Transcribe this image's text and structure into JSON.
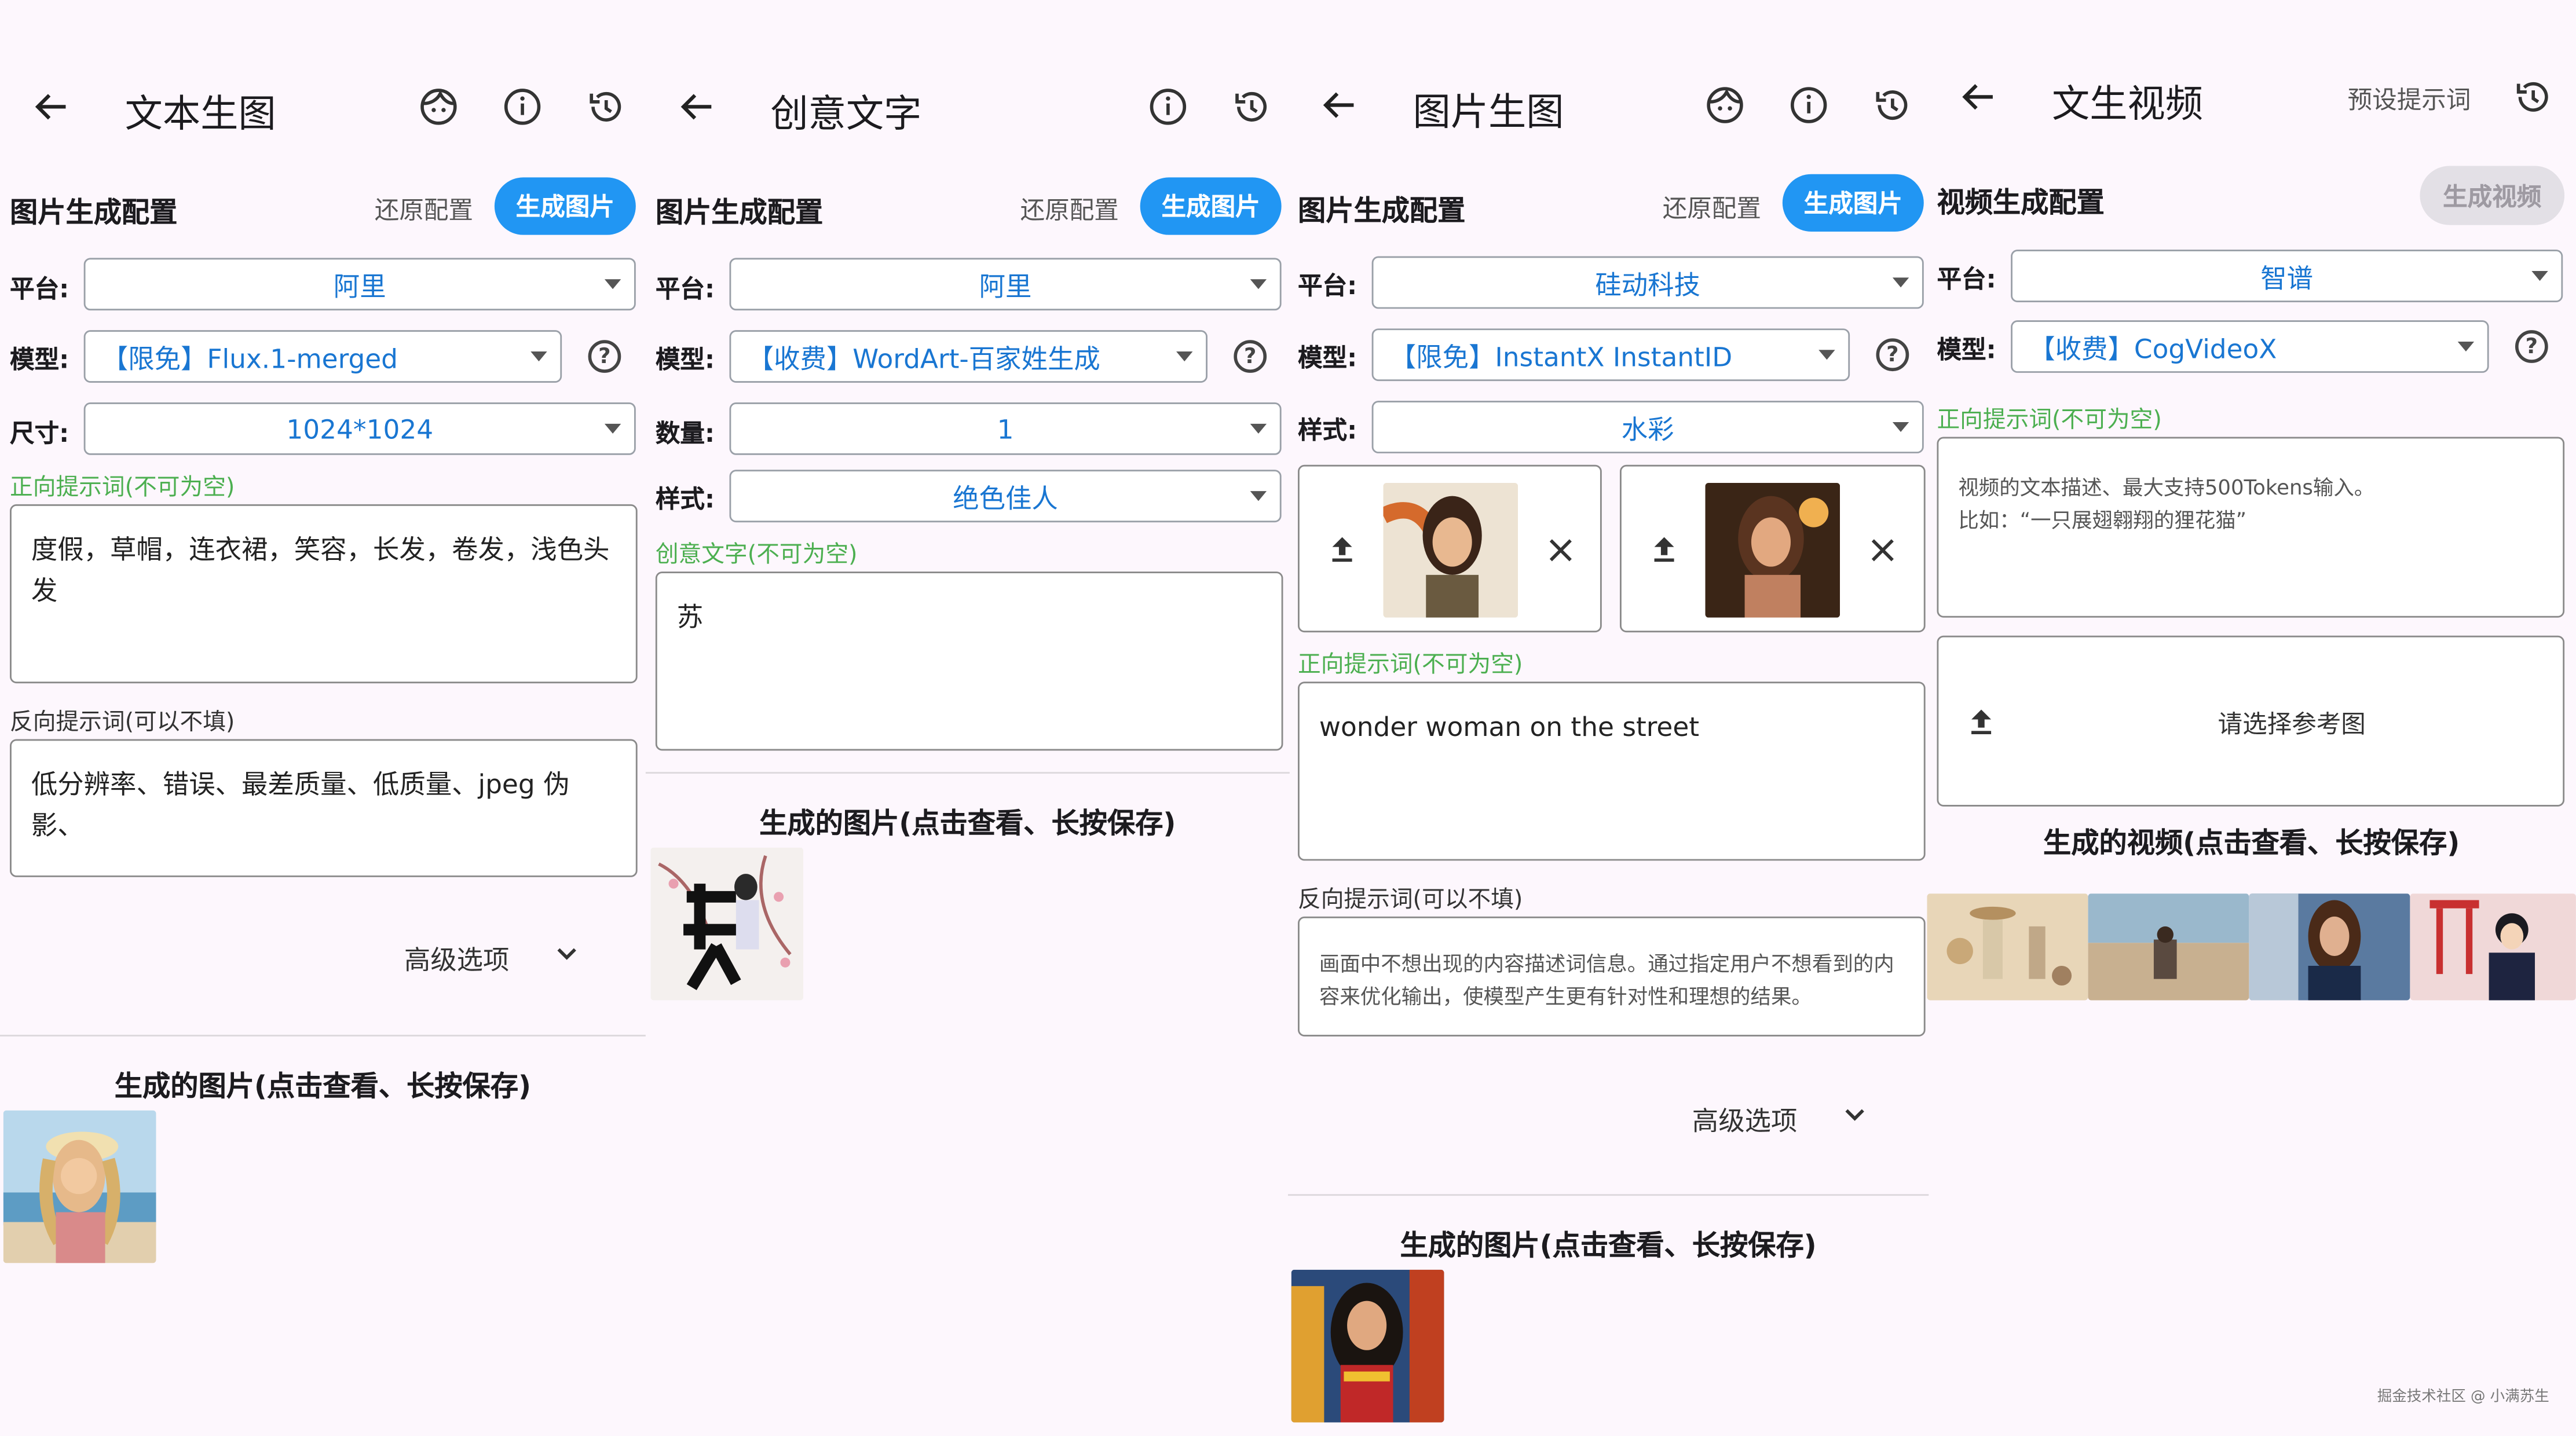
{
  "panel1": {
    "title": "文本生图",
    "section": "图片生成配置",
    "reset": "还原配置",
    "generate": "生成图片",
    "platform_label": "平台:",
    "platform": "阿里",
    "model_label": "模型:",
    "model": "【限免】Flux.1-merged",
    "size_label": "尺寸:",
    "size": "1024*1024",
    "positive_label": "正向提示词(不可为空)",
    "positive_text": "度假，草帽，连衣裙，笑容，长发，卷发，浅色头发",
    "negative_label": "反向提示词(可以不填)",
    "negative_text": "低分辨率、错误、最差质量、低质量、jpeg 伪影、",
    "advanced": "高级选项",
    "result_title": "生成的图片(点击查看、长按保存)"
  },
  "panel2": {
    "title": "创意文字",
    "section": "图片生成配置",
    "reset": "还原配置",
    "generate": "生成图片",
    "platform_label": "平台:",
    "platform": "阿里",
    "model_label": "模型:",
    "model": "【收费】WordArt-百家姓生成",
    "count_label": "数量:",
    "count": "1",
    "style_label": "样式:",
    "style": "绝色佳人",
    "creative_label": "创意文字(不可为空)",
    "creative_text": "苏",
    "result_title": "生成的图片(点击查看、长按保存)"
  },
  "panel3": {
    "title": "图片生图",
    "section": "图片生成配置",
    "reset": "还原配置",
    "generate": "生成图片",
    "platform_label": "平台:",
    "platform": "硅动科技",
    "model_label": "模型:",
    "model": "【限免】InstantX InstantID",
    "style_label": "样式:",
    "style": "水彩",
    "positive_label": "正向提示词(不可为空)",
    "positive_text": "wonder woman on the street",
    "negative_label": "反向提示词(可以不填)",
    "negative_text": "画面中不想出现的内容描述词信息。通过指定用户不想看到的内容来优化输出，使模型产生更有针对性和理想的结果。",
    "advanced": "高级选项",
    "result_title": "生成的图片(点击查看、长按保存)"
  },
  "panel4": {
    "title": "文生视频",
    "preset": "预设提示词",
    "section": "视频生成配置",
    "generate": "生成视频",
    "platform_label": "平台:",
    "platform": "智谱",
    "model_label": "模型:",
    "model": "【收费】CogVideoX",
    "positive_label": "正向提示词(不可为空)",
    "positive_text_1": "视频的文本描述、最大支持500Tokens输入。",
    "positive_text_2": "比如：“一只展翅翱翔的狸花猫”",
    "ref_image": "请选择参考图",
    "result_title": "生成的视频(点击查看、长按保存)"
  },
  "watermark": "掘金技术社区 @ 小满苏生",
  "colors": {
    "accent": "#2196f3",
    "background": "#fdf7fd",
    "green_hint": "#4caf50",
    "select_text": "#1976d2"
  },
  "icons": [
    "back-arrow-icon",
    "face-icon",
    "info-icon",
    "history-icon",
    "help-icon",
    "upload-icon",
    "close-icon",
    "chevron-down-icon"
  ]
}
